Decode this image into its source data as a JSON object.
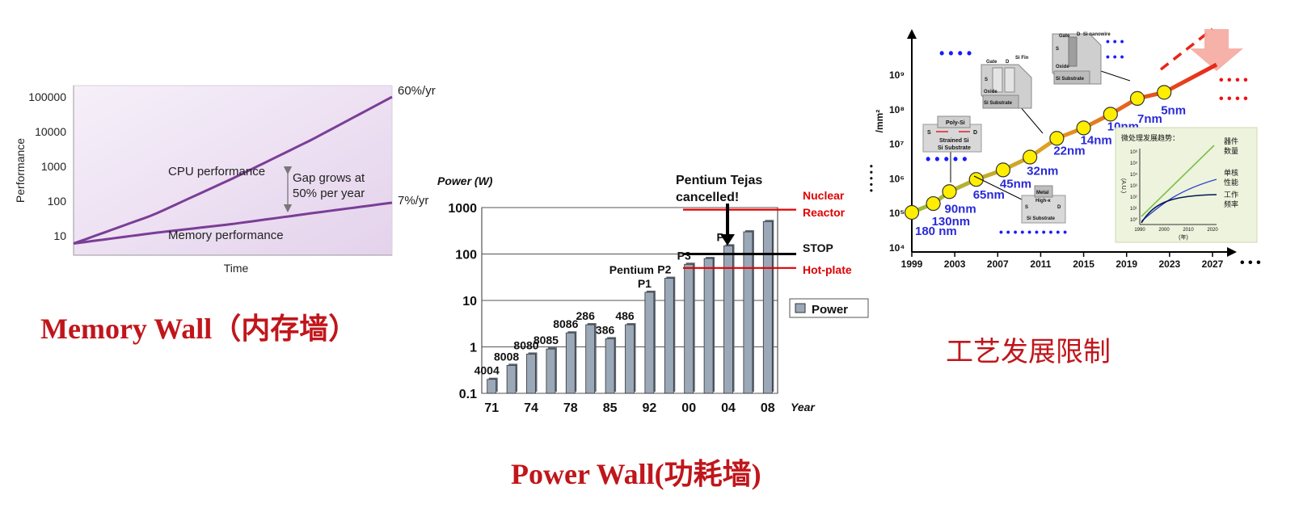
{
  "memory_wall": {
    "caption": "Memory Wall（内存墙）",
    "chart_data": {
      "type": "line",
      "title": "",
      "xlabel": "Time",
      "ylabel": "Performance",
      "yscale": "log",
      "ylim": [
        10,
        100000
      ],
      "ytick_labels": [
        "100000",
        "10000",
        "1000",
        "100",
        "10"
      ],
      "ytick_values": [
        100000,
        10000,
        1000,
        100,
        10
      ],
      "grid": false,
      "series": [
        {
          "name": "CPU performance",
          "rate_label": "60%/yr",
          "x": [
            0,
            0.25,
            0.5,
            0.75,
            1.0
          ],
          "y": [
            6,
            40,
            450,
            6000,
            100000
          ]
        },
        {
          "name": "Memory performance",
          "rate_label": "7%/yr",
          "x": [
            0,
            0.25,
            0.5,
            0.75,
            1.0
          ],
          "y": [
            6,
            12,
            22,
            45,
            90
          ]
        }
      ],
      "annotation": [
        "Gap grows at",
        "50% per year"
      ],
      "colors": {
        "line": "#7a3e96",
        "background": "#eadcf0",
        "arrow": "#666666"
      }
    }
  },
  "power_wall": {
    "caption": "Power Wall(功耗墙)",
    "chart_data": {
      "type": "bar",
      "title": "",
      "ylabel": "Power (W)",
      "xlabel": "Year",
      "yscale": "log",
      "ylim": [
        0.1,
        1000
      ],
      "ytick_labels": [
        "1000",
        "100",
        "10",
        "1",
        "0.1"
      ],
      "ytick_values": [
        1000,
        100,
        10,
        1,
        0.1
      ],
      "xtick_labels": [
        "71",
        "74",
        "78",
        "85",
        "92",
        "00",
        "04",
        "08"
      ],
      "grid": true,
      "legend": {
        "label": "Power",
        "position": "right"
      },
      "values": [
        0.2,
        0.4,
        0.7,
        0.9,
        2,
        3,
        1.5,
        3,
        15,
        30,
        60,
        80,
        150,
        300,
        500
      ],
      "bar_labels": [
        "4004",
        "8008",
        "8080",
        "8085",
        "8086",
        "286",
        "386",
        "486",
        "Pentium\nP1",
        "P2",
        "P3",
        "",
        "P4",
        "",
        ""
      ],
      "reference_lines": [
        {
          "label": "Nuclear Reactor",
          "value": 900,
          "color": "#e00000"
        },
        {
          "label": "STOP",
          "value": 100,
          "color": "#000000"
        },
        {
          "label": "Hot-plate",
          "value": 50,
          "color": "#e00000"
        }
      ],
      "callout": [
        "Pentium Tejas",
        "cancelled!"
      ],
      "colors": {
        "bar": "#9aa8b8",
        "bar_edge": "#333333"
      }
    }
  },
  "process_limit": {
    "caption": "工艺发展限制",
    "chart_data": {
      "type": "line",
      "title": "",
      "ylabel": "/mm²",
      "yscale": "log",
      "ylim": [
        10000,
        10000000000
      ],
      "ytick_labels": [
        "10⁹",
        "10⁸",
        "10⁷",
        "10⁶",
        "10⁵",
        "10⁴"
      ],
      "ytick_values": [
        1000000000,
        100000000,
        10000000,
        1000000,
        100000,
        10000
      ],
      "xlim": [
        1999,
        2027
      ],
      "xtick_labels": [
        "1999",
        "2003",
        "2007",
        "2011",
        "2015",
        "2019",
        "2023",
        "2027"
      ],
      "xtick_values": [
        1999,
        2003,
        2007,
        2011,
        2015,
        2019,
        2023,
        2027
      ],
      "series": [
        {
          "name": "",
          "x": [
            1999,
            2001,
            2002.5,
            2005,
            2007.5,
            2010,
            2012.5,
            2015,
            2017.5,
            2020,
            2022.5
          ],
          "y": [
            100000,
            180000,
            400000,
            900000,
            1700000,
            4000000,
            14000000,
            28000000,
            70000000,
            200000000,
            300000000
          ]
        }
      ],
      "node_labels": [
        "180 nm",
        "130nm",
        "90nm",
        "65nm",
        "45nm",
        "32nm",
        "22nm",
        "14nm",
        "10nm",
        "7nm",
        "5nm"
      ],
      "inset": {
        "title": "微处理发展趋势：",
        "ylabel": "(A.U.)",
        "xlabel": "(年)",
        "xtick_labels": [
          "1990",
          "2000",
          "2010",
          "2020"
        ],
        "ytick_labels": [
          "10⁶",
          "10⁵",
          "10⁴",
          "10³",
          "10²",
          "10¹",
          "10⁰"
        ],
        "legend": [
          "器件\n数量",
          "单核\n性能",
          "工作\n频率"
        ]
      },
      "diagram_labels": {
        "strained": [
          "Poly-Si",
          "S",
          "D",
          "Strained Si",
          "Si Substrate"
        ],
        "metal_gate": [
          "Metal",
          "High-κ",
          "S",
          "D",
          "Si Substrate"
        ],
        "finfet": [
          "Gate",
          "D",
          "Si Fin",
          "S",
          "Oxide",
          "Si Substrate"
        ],
        "nanowire": [
          "Gate",
          "D",
          "Si nanowire",
          "S",
          "Oxide",
          "Si Substrate"
        ]
      },
      "colors": {
        "node_fill": "#ffee00",
        "node_label": "#2a2ad8",
        "dots_blue": "#1a1aff",
        "dots_red": "#ee1111"
      }
    }
  }
}
